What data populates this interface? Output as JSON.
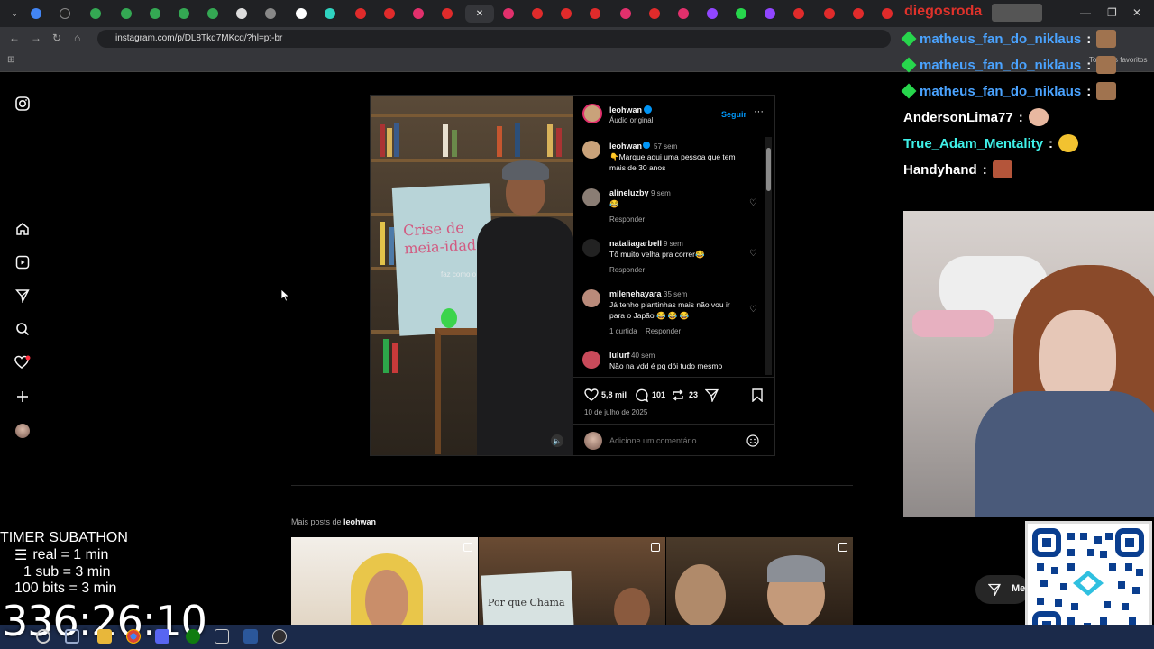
{
  "browser": {
    "url": "instagram.com/p/DL8Tkd7MKcq/?hl=pt-br",
    "bookmarks_right": "Todos os favoritos",
    "overlay_name": "diegosroda"
  },
  "post": {
    "author": "leohwan",
    "audio": "Áudio original",
    "follow_label": "Seguir",
    "board_text": "Crise de meia-idade",
    "overlay_caption": "faz como o Flash",
    "caption": {
      "user": "leohwan",
      "time": "57 sem",
      "text": "👇Marque aqui uma pessoa que tem mais de 30 anos"
    },
    "comments": [
      {
        "user": "alineluzby",
        "time": "9 sem",
        "text": "😂",
        "reply": "Responder",
        "likes": ""
      },
      {
        "user": "nataliagarbell",
        "time": "9 sem",
        "text": "Tô muito velha pra correr😂",
        "reply": "Responder",
        "likes": ""
      },
      {
        "user": "milenehayara",
        "time": "35 sem",
        "text": "Já tenho plantinhas mais não vou ir para o Japão 😂 😂 😂",
        "reply": "Responder",
        "likes": "1 curtida"
      },
      {
        "user": "lulurf",
        "time": "40 sem",
        "text": "Não na vdd é pq dói tudo mesmo",
        "reply": "",
        "likes": ""
      }
    ],
    "like_count": "5,8 mil",
    "comment_count": "101",
    "share_count": "23",
    "date": "10 de julho de 2025",
    "add_comment_placeholder": "Adicione um comentário..."
  },
  "more_posts": {
    "prefix": "Mais posts de",
    "user": "leohwan",
    "thumb2_text": "Por que Chama"
  },
  "messages_button": "Mer",
  "chat": [
    {
      "user": "matheus_fan_do_niklaus",
      "sep": ":",
      "color": "#4aa3ff",
      "badge": true
    },
    {
      "user": "matheus_fan_do_niklaus",
      "sep": ":",
      "color": "#4aa3ff",
      "badge": true
    },
    {
      "user": "matheus_fan_do_niklaus",
      "sep": ":",
      "color": "#4aa3ff",
      "badge": true
    },
    {
      "user": "AndersonLima77",
      "sep": ":",
      "color": "#ffffff",
      "badge": false
    },
    {
      "user": "True_Adam_Mentality",
      "sep": ":",
      "color": "#3ff0e8",
      "badge": false
    },
    {
      "user": "Handyhand",
      "sep": ":",
      "color": "#ffffff",
      "badge": false
    }
  ],
  "timer": {
    "title": "TIMER SUBATHON",
    "line1": "real = 1 min",
    "line2": "1 sub = 3 min",
    "line3": "100 bits = 3 min",
    "value": "336:26:10"
  },
  "colors": {
    "ig_blue": "#0095f6",
    "chat_badge_green": "#27d64c",
    "notif_red": "#ff3040"
  }
}
